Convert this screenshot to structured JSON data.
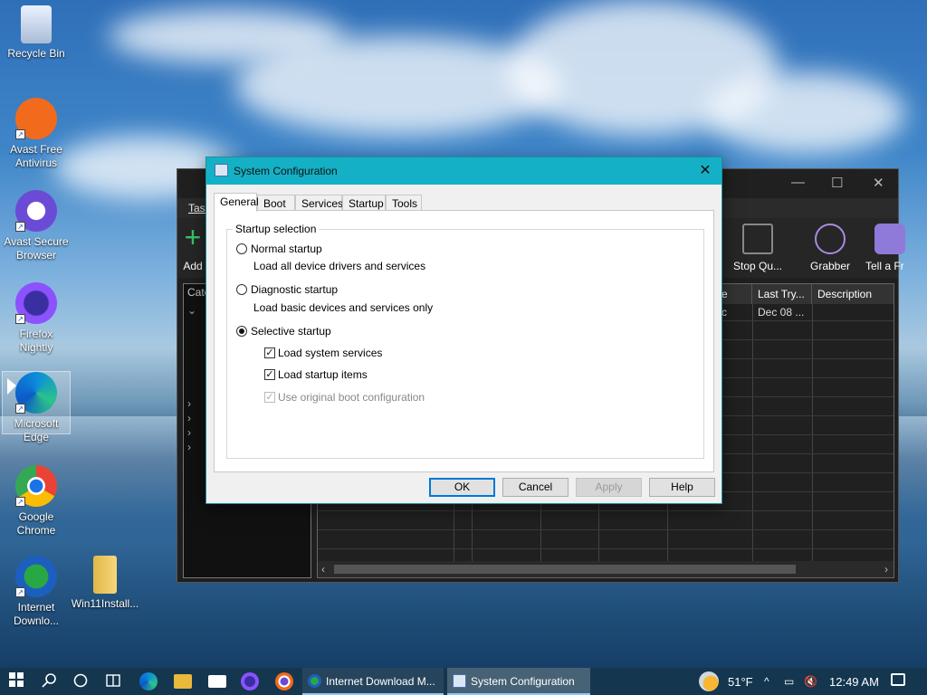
{
  "desktop": {
    "icons": [
      {
        "label": "Recycle Bin"
      },
      {
        "label": "Avast Free Antivirus"
      },
      {
        "label": "Avast Secure Browser"
      },
      {
        "label": "Firefox Nightly"
      },
      {
        "label": "Microsoft Edge"
      },
      {
        "label": "Google Chrome"
      },
      {
        "label": "Internet Downlo..."
      },
      {
        "label": "Win11Install..."
      }
    ]
  },
  "idm": {
    "menu_task": "Task",
    "toolbar": {
      "add": "Add",
      "stop_queue": "Stop Qu...",
      "grabber": "Grabber",
      "tell_friend": "Tell a Fr"
    },
    "categories_header": "Cate",
    "columns": {
      "col_e": "e",
      "last_try": "Last Try...",
      "description": "Description"
    },
    "row": {
      "col_e": "c",
      "last_try": "Dec 08 ..."
    }
  },
  "dialog": {
    "title": "System Configuration",
    "tabs": [
      {
        "label": "General",
        "active": true
      },
      {
        "label": "Boot"
      },
      {
        "label": "Services"
      },
      {
        "label": "Startup"
      },
      {
        "label": "Tools"
      }
    ],
    "group_label": "Startup selection",
    "normal": {
      "label": "Normal startup",
      "desc": "Load all device drivers and services",
      "selected": false
    },
    "diagnostic": {
      "label": "Diagnostic startup",
      "desc": "Load basic devices and services only",
      "selected": false
    },
    "selective": {
      "label": "Selective startup",
      "selected": true
    },
    "load_system_services": {
      "label": "Load system services",
      "checked": true
    },
    "load_startup_items": {
      "label": "Load startup items",
      "checked": true
    },
    "use_original_boot": {
      "label": "Use original boot configuration",
      "checked": true,
      "disabled": true
    },
    "buttons": {
      "ok": "OK",
      "cancel": "Cancel",
      "apply": "Apply",
      "help": "Help"
    }
  },
  "taskbar": {
    "apps": [
      {
        "label": "Internet Download M..."
      },
      {
        "label": "System Configuration",
        "active": true
      }
    ],
    "weather": "51°F",
    "time": "12:49 AM"
  },
  "colors": {
    "dialog_title_bg": "#14b1c6",
    "taskbar_bg": "#14364f",
    "accent": "#0078d7"
  }
}
